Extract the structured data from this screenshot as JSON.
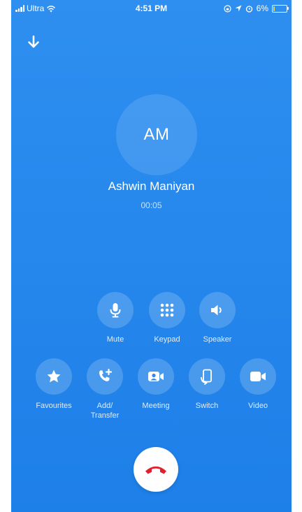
{
  "status_bar": {
    "carrier": "Ultra",
    "time": "4:51 PM",
    "battery": "6%",
    "battery_level": 0.06
  },
  "call": {
    "initials": "AM",
    "name": "Ashwin Maniyan",
    "duration": "00:05"
  },
  "controls_row1": [
    {
      "label": "Mute",
      "icon": "microphone-icon"
    },
    {
      "label": "Keypad",
      "icon": "keypad-icon"
    },
    {
      "label": "Speaker",
      "icon": "speaker-icon"
    }
  ],
  "controls_row2": [
    {
      "label": "Favourites",
      "icon": "star-icon"
    },
    {
      "label": "Add/\nTransfer",
      "icon": "add-call-icon"
    },
    {
      "label": "Meeting",
      "icon": "meeting-icon"
    },
    {
      "label": "Switch",
      "icon": "switch-device-icon"
    },
    {
      "label": "Video",
      "icon": "video-icon"
    }
  ],
  "colors": {
    "background": "#1d7fe8",
    "end_call_icon": "#e0202a",
    "battery_fill": "#ffd83a"
  }
}
